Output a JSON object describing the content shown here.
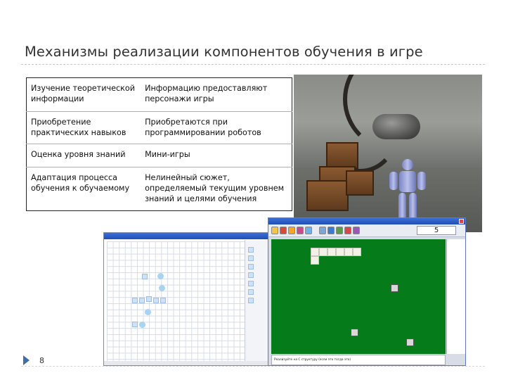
{
  "slide": {
    "title": "Механизмы реализации компонентов обучения в игре",
    "page_number": "8"
  },
  "table": {
    "rows": [
      {
        "component": "Изучение теоретической информации",
        "mechanism": "Информацию предоставляют персонажи игры"
      },
      {
        "component": "Приобретение практических навыков",
        "mechanism": "Приобретаются при программировании роботов"
      },
      {
        "component": "Оценка уровня знаний",
        "mechanism": "Мини-игры"
      },
      {
        "component": "Адаптация процесса обучения к обучаемому",
        "mechanism": "Нелинейный сюжет, определяемый текущим уровнем знаний и целями обучения"
      }
    ]
  },
  "game_window": {
    "score": "5",
    "status_text": "Реализуйте на С структуру (если это тогда это)",
    "field_color": "#067b1a"
  },
  "icons": {
    "page_marker": "triangle-bullet-icon"
  }
}
